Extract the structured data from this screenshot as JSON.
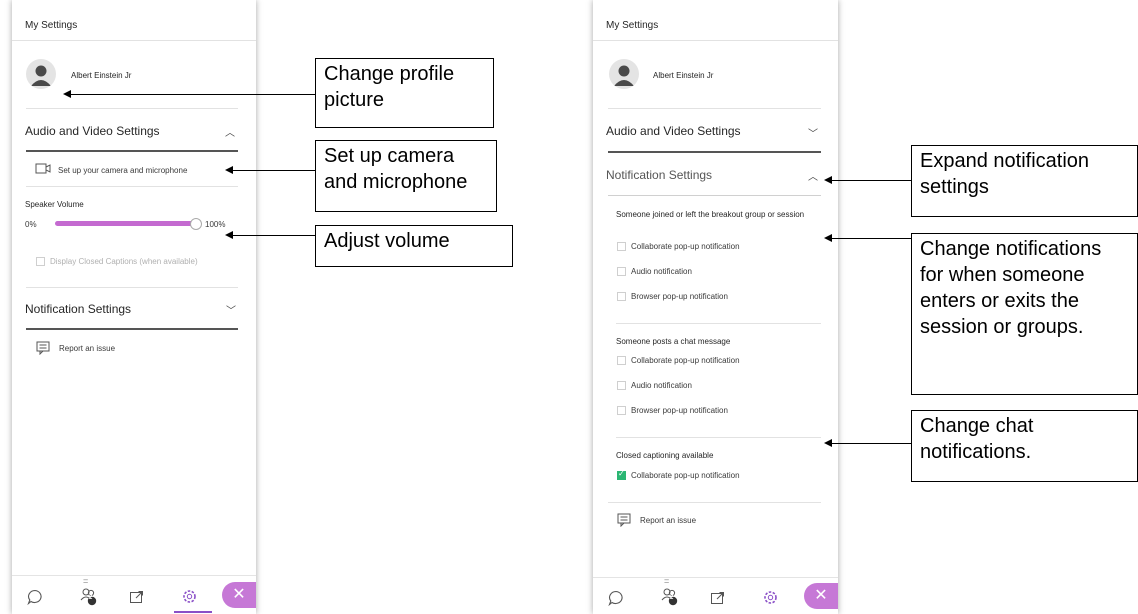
{
  "panel_left": {
    "title": "My Settings",
    "user_name": "Albert Einstein Jr",
    "audio_video_title": "Audio and Video Settings",
    "camera_setup_label": "Set up your camera and microphone",
    "speaker_volume_label": "Speaker Volume",
    "volume_min_label": "0%",
    "volume_max_label": "100%",
    "volume_level": 0.95,
    "closed_captions_label": "Display Closed Captions (when available)",
    "notification_settings_title": "Notification Settings",
    "report_issue_label": "Report an issue",
    "audio_video_expanded": true,
    "notifications_expanded": false
  },
  "panel_right": {
    "title": "My Settings",
    "user_name": "Albert Einstein Jr",
    "audio_video_title": "Audio and Video Settings",
    "notification_settings_title": "Notification Settings",
    "group_join": {
      "heading": "Someone joined or left the breakout group or session",
      "options": [
        {
          "label": "Collaborate pop-up notification",
          "checked": false
        },
        {
          "label": "Audio notification",
          "checked": false
        },
        {
          "label": "Browser pop-up notification",
          "checked": false
        }
      ]
    },
    "group_chat": {
      "heading": "Someone posts a chat message",
      "options": [
        {
          "label": "Collaborate pop-up notification",
          "checked": false
        },
        {
          "label": "Audio notification",
          "checked": false
        },
        {
          "label": "Browser pop-up notification",
          "checked": false
        }
      ]
    },
    "group_captions": {
      "heading": "Closed captioning available",
      "options": [
        {
          "label": "Collaborate pop-up notification",
          "checked": true
        }
      ]
    },
    "report_issue_label": "Report an issue",
    "audio_video_expanded": false,
    "notifications_expanded": true
  },
  "bottom_bar": {
    "icons": [
      "chat-icon",
      "participants-icon",
      "share-content-icon",
      "settings-icon",
      "close-icon"
    ],
    "participants_badge": "2",
    "active_tab": "settings"
  },
  "callouts": {
    "change_profile_picture": "Change profile picture",
    "set_up_camera": "Set up camera and microphone",
    "adjust_volume": "Adjust volume",
    "expand_notification": "Expand notification settings",
    "change_enter_exit": "Change notifications for when someone enters or exits the session or groups.",
    "change_chat": "Change chat notifications."
  },
  "colors": {
    "accent_purple": "#c46ad0",
    "active_tab_purple": "#8a4fc7",
    "checkbox_green": "#2bb673"
  }
}
